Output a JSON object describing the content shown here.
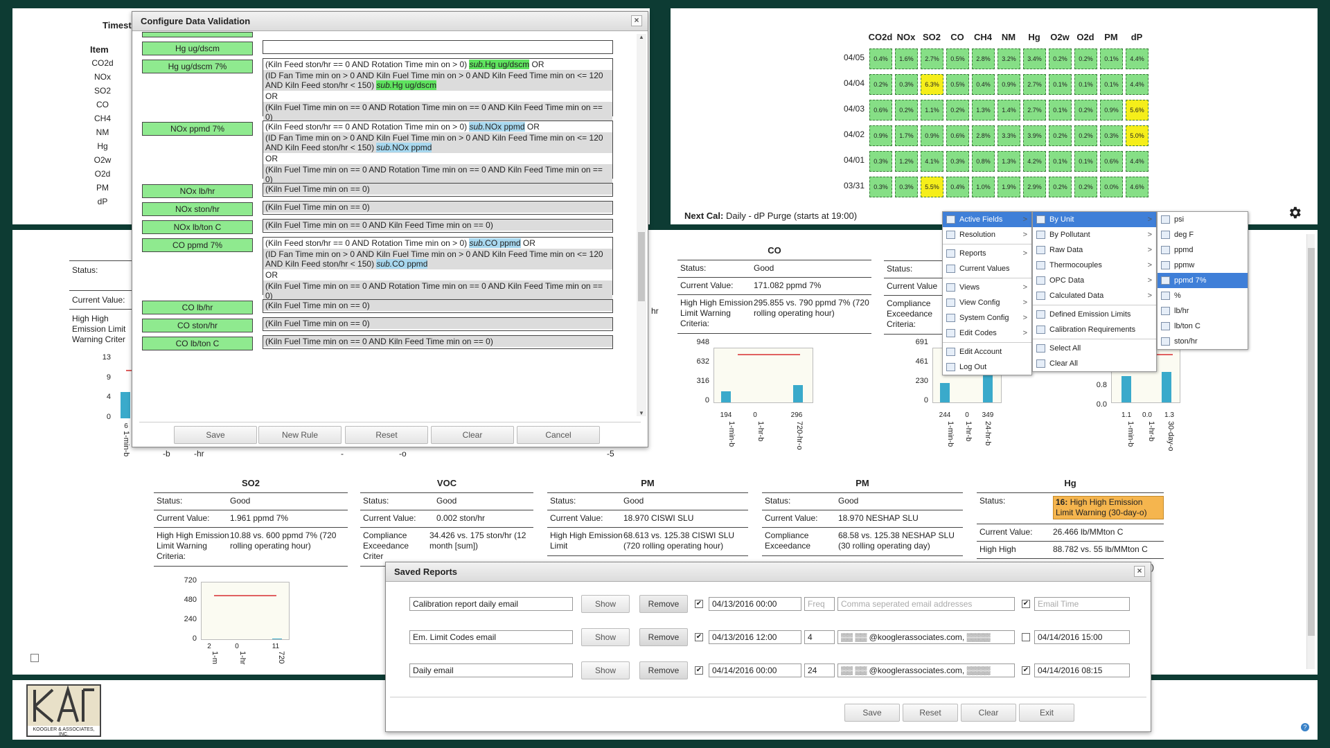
{
  "heatmap": {
    "columns": [
      "CO2d",
      "NOx",
      "SO2",
      "CO",
      "CH4",
      "NM",
      "Hg",
      "O2w",
      "O2d",
      "PM",
      "dP"
    ],
    "rows": [
      {
        "date": "04/05",
        "cells": [
          "0.4%",
          "1.6%",
          "2.7%",
          "0.5%",
          "2.8%",
          "3.2%",
          "3.4%",
          "0.2%",
          "0.2%",
          "0.1%",
          "4.4%"
        ]
      },
      {
        "date": "04/04",
        "cells": [
          "0.2%",
          "0.3%",
          "6.3%",
          "0.5%",
          "0.4%",
          "0.9%",
          "2.7%",
          "0.1%",
          "0.1%",
          "0.1%",
          "4.4%"
        ]
      },
      {
        "date": "04/03",
        "cells": [
          "0.6%",
          "0.2%",
          "1.1%",
          "0.2%",
          "1.3%",
          "1.4%",
          "2.7%",
          "0.1%",
          "0.2%",
          "0.9%",
          "5.6%"
        ]
      },
      {
        "date": "04/02",
        "cells": [
          "0.9%",
          "1.7%",
          "0.9%",
          "0.6%",
          "2.8%",
          "3.3%",
          "3.9%",
          "0.2%",
          "0.2%",
          "0.3%",
          "5.0%"
        ]
      },
      {
        "date": "04/01",
        "cells": [
          "0.3%",
          "1.2%",
          "4.1%",
          "0.3%",
          "0.8%",
          "1.3%",
          "4.2%",
          "0.1%",
          "0.1%",
          "0.6%",
          "4.4%"
        ]
      },
      {
        "date": "03/31",
        "cells": [
          "0.3%",
          "0.3%",
          "5.5%",
          "0.4%",
          "1.0%",
          "1.9%",
          "2.9%",
          "0.2%",
          "0.2%",
          "0.0%",
          "4.6%"
        ]
      }
    ],
    "next_cal_label": "Next Cal:",
    "next_cal_value": "Daily - dP Purge (starts at 19:00)"
  },
  "left_list": {
    "partial_title": "Timest",
    "header": "Item",
    "items": [
      "CO2d",
      "NOx",
      "SO2",
      "CO",
      "CH4",
      "NM",
      "Hg",
      "O2w",
      "O2d",
      "PM",
      "dP"
    ]
  },
  "bg_partial": {
    "status": "Status:",
    "current_value": "Current Value:",
    "high_high": "High High",
    "emission_limit": "Emission Limit",
    "warning_criteria": "Warning Criter",
    "y": [
      "13",
      "9",
      "4",
      "0"
    ],
    "x": [
      "6",
      "1-min-b"
    ],
    "frag_hr": "hr",
    "frag_b": "-b",
    "frag_o": "-o",
    "frag_5": "-5",
    "frag_dash": "-",
    "frag_hr2": "-hr"
  },
  "co_panel": {
    "title": "CO",
    "status_label": "Status:",
    "status": "Good",
    "cv_label": "Current Value:",
    "cv": "171.082 ppmd 7%",
    "crit_label": "High High Emission Limit Warning Criteria:",
    "crit": "295.855 vs. 790 ppmd 7% (720 rolling operating hour)",
    "y": [
      "948",
      "632",
      "316",
      "0"
    ],
    "bar_values": [
      "194",
      "0",
      "296"
    ],
    "x": [
      "1-min-b",
      "1-hr-b",
      "720-hr-o"
    ]
  },
  "co_mid_panel": {
    "status_label": "Status:",
    "cv_label": "Current Value",
    "crit_label": "Compliance Exceedance Criteria:",
    "y": [
      "691",
      "461",
      "230",
      "0"
    ],
    "bar_values": [
      "244",
      "0",
      "349"
    ],
    "x": [
      "1-min-b",
      "1-hr-b",
      "24-hr-b"
    ]
  },
  "right_mini": {
    "y": [
      "0.8",
      "0.0"
    ],
    "bar_values": [
      "1.1",
      "0.0",
      "1.3"
    ],
    "x": [
      "1-min-b",
      "1-hr-b",
      "30-day-o"
    ]
  },
  "so2_panel": {
    "title": "SO2",
    "status_label": "Status:",
    "status": "Good",
    "cv_label": "Current Value:",
    "cv": "1.961 ppmd 7%",
    "crit_label": "High High Emission Limit Warning Criteria:",
    "crit": "10.88 vs. 600 ppmd 7% (720 rolling operating hour)",
    "y": [
      "720",
      "480",
      "240",
      "0"
    ],
    "bar_values": [
      "2",
      "0",
      "11"
    ],
    "x": [
      "1-m",
      "1-hr",
      "720"
    ]
  },
  "voc_panel": {
    "title": "VOC",
    "status_label": "Status:",
    "status": "Good",
    "cv_label": "Current Value:",
    "cv": "0.002 ston/hr",
    "crit_label": "Compliance Exceedance Criter",
    "crit": "34.426 vs. 175 ston/hr (12 month [sum])"
  },
  "pm1_panel": {
    "title": "PM",
    "status_label": "Status:",
    "status": "Good",
    "cv_label": "Current Value:",
    "cv": "18.970 CISWI SLU",
    "crit_label": "High High Emission Limit",
    "crit": "68.613 vs. 125.38 CISWI SLU (720 rolling operating hour)"
  },
  "pm2_panel": {
    "title": "PM",
    "status_label": "Status:",
    "status": "Good",
    "cv_label": "Current Value:",
    "cv": "18.970 NESHAP SLU",
    "crit_label": "Compliance Exceedance",
    "crit": "68.58 vs. 125.38 NESHAP SLU (30 rolling operating day)"
  },
  "hg_panel": {
    "title": "Hg",
    "status_label": "Status:",
    "status_code": "16:",
    "status": "High High Emission Limit Warning (30-day-o)",
    "cv_label": "Current Value:",
    "cv": "26.466 lb/MMton C",
    "crit_label": "High High",
    "crit": "88.782 vs. 55 lb/MMton C",
    "crit_tail": "y)"
  },
  "config_dialog": {
    "title": "Configure Data Validation",
    "close": "×",
    "fields": [
      {
        "label": "Hg ug/dscm",
        "lines": []
      },
      {
        "label": "Hg ug/dscm 7%",
        "lines": [
          {
            "pre": "(Kiln Feed ston/hr == 0 AND Rotation Time min on > 0) ",
            "sub": "sub.",
            "hl": "Hg ug/dscm",
            "post": "  OR",
            "hlc": "g",
            "gray": false
          },
          {
            "pre": "(ID Fan Time min on > 0 AND Kiln Fuel Time min on > 0 AND Kiln Feed Time min on <= 120 AND Kiln Feed ston/hr < 150) ",
            "sub": "sub.",
            "hl": "Hg ug/dscm",
            "post": "",
            "hlc": "g",
            "gray": true
          },
          {
            "pre": "OR",
            "sub": "",
            "hl": "",
            "post": "",
            "hlc": "",
            "gray": false
          },
          {
            "pre": "(Kiln Fuel Time min on == 0 AND Rotation Time min on == 0 AND Kiln Feed Time min on == 0)",
            "sub": "",
            "hl": "",
            "post": "",
            "hlc": "",
            "gray": true
          }
        ]
      },
      {
        "label": "NOx ppmd 7%",
        "lines": [
          {
            "pre": "(Kiln Feed ston/hr == 0 AND Rotation Time min on > 0) ",
            "sub": "sub.",
            "hl": "NOx ppmd",
            "post": "  OR",
            "hlc": "b",
            "gray": false
          },
          {
            "pre": "(ID Fan Time min on > 0 AND Kiln Fuel Time min on > 0 AND Kiln Feed Time min on <= 120 AND Kiln Feed ston/hr < 150) ",
            "sub": "sub.",
            "hl": "NOx ppmd",
            "post": "",
            "hlc": "b",
            "gray": true
          },
          {
            "pre": "OR",
            "sub": "",
            "hl": "",
            "post": "",
            "hlc": "",
            "gray": false
          },
          {
            "pre": "(Kiln Fuel Time min on == 0 AND Rotation Time min on == 0 AND Kiln Feed Time min on == 0)",
            "sub": "",
            "hl": "",
            "post": "",
            "hlc": "",
            "gray": true
          }
        ]
      },
      {
        "label": "NOx lb/hr",
        "lines": [
          {
            "pre": "(Kiln Fuel Time min on == 0)",
            "sub": "",
            "hl": "",
            "post": "",
            "hlc": "",
            "gray": true
          }
        ]
      },
      {
        "label": "NOx ston/hr",
        "lines": [
          {
            "pre": "(Kiln Fuel Time min on == 0)",
            "sub": "",
            "hl": "",
            "post": "",
            "hlc": "",
            "gray": true
          }
        ]
      },
      {
        "label": "NOx lb/ton C",
        "lines": [
          {
            "pre": "(Kiln Fuel Time min on == 0 AND Kiln Feed Time min on == 0)",
            "sub": "",
            "hl": "",
            "post": "",
            "hlc": "",
            "gray": true
          }
        ]
      },
      {
        "label": "CO ppmd 7%",
        "lines": [
          {
            "pre": "(Kiln Feed ston/hr == 0 AND Rotation Time min on > 0) ",
            "sub": "sub.",
            "hl": "CO ppmd",
            "post": "  OR",
            "hlc": "b",
            "gray": false
          },
          {
            "pre": "(ID Fan Time min on > 0 AND Kiln Fuel Time min on > 0 AND Kiln Feed Time min on <= 120 AND Kiln Feed ston/hr < 150) ",
            "sub": "sub.",
            "hl": "CO ppmd",
            "post": "",
            "hlc": "b",
            "gray": true
          },
          {
            "pre": "OR",
            "sub": "",
            "hl": "",
            "post": "",
            "hlc": "",
            "gray": false
          },
          {
            "pre": "(Kiln Fuel Time min on == 0 AND Rotation Time min on == 0 AND Kiln Feed Time min on == 0)",
            "sub": "",
            "hl": "",
            "post": "",
            "hlc": "",
            "gray": true
          }
        ]
      },
      {
        "label": "CO lb/hr",
        "lines": [
          {
            "pre": "(Kiln Fuel Time min on == 0)",
            "sub": "",
            "hl": "",
            "post": "",
            "hlc": "",
            "gray": true
          }
        ]
      },
      {
        "label": "CO ston/hr",
        "lines": [
          {
            "pre": "(Kiln Fuel Time min on == 0)",
            "sub": "",
            "hl": "",
            "post": "",
            "hlc": "",
            "gray": true
          }
        ]
      },
      {
        "label": "CO lb/ton C",
        "lines": [
          {
            "pre": "(Kiln Fuel Time min on == 0 AND Kiln Feed Time min on == 0)",
            "sub": "",
            "hl": "",
            "post": "",
            "hlc": "",
            "gray": true
          }
        ]
      }
    ],
    "buttons": [
      "Save",
      "New Rule",
      "Reset",
      "Clear",
      "Cancel"
    ]
  },
  "context_menu": {
    "main": [
      {
        "label": "Active Fields",
        "arrow": ">",
        "sel": true
      },
      {
        "label": "Resolution",
        "arrow": ">",
        "sel": false
      },
      {
        "label": "Reports",
        "arrow": ">",
        "sel": false
      },
      {
        "label": "Current Values",
        "arrow": "",
        "sel": false
      },
      {
        "label": "Views",
        "arrow": ">",
        "sel": false
      },
      {
        "label": "View Config",
        "arrow": ">",
        "sel": false
      },
      {
        "label": "System Config",
        "arrow": ">",
        "sel": false
      },
      {
        "label": "Edit Codes",
        "arrow": ">",
        "sel": false
      },
      {
        "label": "Edit Account",
        "arrow": "",
        "sel": false
      },
      {
        "label": "Log Out",
        "arrow": "",
        "sel": false
      }
    ],
    "sub1": [
      {
        "label": "By Unit",
        "arrow": ">",
        "sel": true
      },
      {
        "label": "By Pollutant",
        "arrow": ">",
        "sel": false
      },
      {
        "label": "Raw Data",
        "arrow": ">",
        "sel": false
      },
      {
        "label": "Thermocouples",
        "arrow": ">",
        "sel": false
      },
      {
        "label": "OPC Data",
        "arrow": ">",
        "sel": false
      },
      {
        "label": "Calculated Data",
        "arrow": ">",
        "sel": false
      },
      {
        "label": "Defined Emission Limits",
        "arrow": "",
        "sel": false
      },
      {
        "label": "Calibration Requirements",
        "arrow": "",
        "sel": false
      },
      {
        "label": "Select All",
        "arrow": "",
        "sel": false
      },
      {
        "label": "Clear All",
        "arrow": "",
        "sel": false
      }
    ],
    "sub2": [
      {
        "label": "psi",
        "sel": false
      },
      {
        "label": "deg F",
        "sel": false
      },
      {
        "label": "ppmd",
        "sel": false
      },
      {
        "label": "ppmw",
        "sel": false
      },
      {
        "label": "ppmd 7%",
        "sel": true
      },
      {
        "label": "%",
        "sel": false
      },
      {
        "label": "lb/hr",
        "sel": false
      },
      {
        "label": "lb/ton C",
        "sel": false
      },
      {
        "label": "ston/hr",
        "sel": false
      }
    ]
  },
  "saved_reports": {
    "title": "Saved Reports",
    "close": "×",
    "rows": [
      {
        "name": "Calibration report daily email",
        "show": "Show",
        "remove": "Remove",
        "checked1": true,
        "start": "04/13/2016 00:00",
        "freq": "",
        "freq_ph": "Freq",
        "emails": "",
        "emails_ph": "Comma seperated email addresses",
        "checked2": true,
        "time": "",
        "time_ph": "Email Time"
      },
      {
        "name": "Em. Limit Codes email",
        "show": "Show",
        "remove": "Remove",
        "checked1": true,
        "start": "04/13/2016 12:00",
        "freq": "4",
        "freq_ph": "",
        "emails": "▒▒ ▒▒ @kooglerassociates.com, ▒▒▒▒",
        "emails_ph": "",
        "checked2": false,
        "time": "04/14/2016 15:00",
        "time_ph": ""
      },
      {
        "name": "Daily email",
        "show": "Show",
        "remove": "Remove",
        "checked1": true,
        "start": "04/14/2016 00:00",
        "freq": "24",
        "freq_ph": "",
        "emails": "▒▒ ▒▒ @kooglerassociates.com, ▒▒▒▒",
        "emails_ph": "",
        "checked2": true,
        "time": "04/14/2016 08:15",
        "time_ph": ""
      }
    ],
    "buttons": [
      "Save",
      "Reset",
      "Clear",
      "Exit"
    ]
  },
  "footer": {
    "logo_text": "KOOGLER & ASSOCIATES, INC."
  }
}
